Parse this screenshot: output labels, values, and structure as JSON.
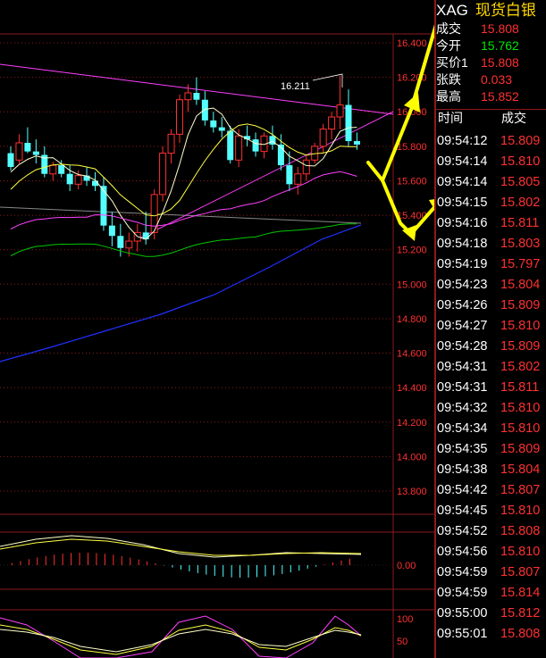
{
  "quote": {
    "code": "XAG",
    "name": "现货白银",
    "rows": [
      {
        "label": "成交",
        "value": "15.808",
        "color": "#ff3030"
      },
      {
        "label": "今开",
        "value": "15.762",
        "color": "#00e600"
      },
      {
        "label": "买价1",
        "value": "15.808",
        "color": "#ff3030"
      },
      {
        "label": "张跌",
        "value": "0.033",
        "color": "#ff3030"
      },
      {
        "label": "最高",
        "value": "15.852",
        "color": "#ff3030"
      }
    ]
  },
  "ticks": {
    "headers": [
      "时间",
      "成交"
    ],
    "rows": [
      {
        "time": "09:54:12",
        "price": "15.809"
      },
      {
        "time": "09:54:14",
        "price": "15.810"
      },
      {
        "time": "09:54:14",
        "price": "15.805"
      },
      {
        "time": "09:54:15",
        "price": "15.802"
      },
      {
        "time": "09:54:16",
        "price": "15.811"
      },
      {
        "time": "09:54:18",
        "price": "15.803"
      },
      {
        "time": "09:54:19",
        "price": "15.797"
      },
      {
        "time": "09:54:23",
        "price": "15.804"
      },
      {
        "time": "09:54:26",
        "price": "15.809"
      },
      {
        "time": "09:54:27",
        "price": "15.810"
      },
      {
        "time": "09:54:28",
        "price": "15.809"
      },
      {
        "time": "09:54:31",
        "price": "15.802"
      },
      {
        "time": "09:54:31",
        "price": "15.811"
      },
      {
        "time": "09:54:32",
        "price": "15.810"
      },
      {
        "time": "09:54:34",
        "price": "15.810"
      },
      {
        "time": "09:54:35",
        "price": "15.809"
      },
      {
        "time": "09:54:38",
        "price": "15.804"
      },
      {
        "time": "09:54:42",
        "price": "15.807"
      },
      {
        "time": "09:54:45",
        "price": "15.810"
      },
      {
        "time": "09:54:52",
        "price": "15.808"
      },
      {
        "time": "09:54:56",
        "price": "15.810"
      },
      {
        "time": "09:54:59",
        "price": "15.807"
      },
      {
        "time": "09:54:59",
        "price": "15.814"
      },
      {
        "time": "09:55:00",
        "price": "15.812"
      },
      {
        "time": "09:55:01",
        "price": "15.808"
      }
    ]
  },
  "chart": {
    "y_ticks": [
      "16.400",
      "16.200",
      "16.000",
      "15.800",
      "15.600",
      "15.400",
      "15.200",
      "15.000",
      "14.800",
      "14.600",
      "14.400",
      "14.200",
      "14.000",
      "13.800"
    ],
    "peak_label": "16.211",
    "macd_zero_label": "0.00",
    "kdj_labels": [
      "100",
      "50"
    ]
  },
  "colors": {
    "grid": "#8b1a1a",
    "up": "#ff3030",
    "down": "#54ffff",
    "ma5": "#ffffcc",
    "ma10": "#ffff40",
    "ma20": "#ff40ff",
    "ma60": "#00c800",
    "ma120": "#2030ff",
    "arrows": "#ffff00"
  },
  "chart_data": {
    "type": "candlestick",
    "candles": [
      {
        "o": 15.76,
        "h": 15.8,
        "l": 15.66,
        "c": 15.68
      },
      {
        "o": 15.72,
        "h": 15.87,
        "l": 15.7,
        "c": 15.82
      },
      {
        "o": 15.82,
        "h": 15.91,
        "l": 15.76,
        "c": 15.77
      },
      {
        "o": 15.77,
        "h": 15.84,
        "l": 15.7,
        "c": 15.75
      },
      {
        "o": 15.75,
        "h": 15.8,
        "l": 15.62,
        "c": 15.64
      },
      {
        "o": 15.64,
        "h": 15.71,
        "l": 15.6,
        "c": 15.69
      },
      {
        "o": 15.69,
        "h": 15.72,
        "l": 15.62,
        "c": 15.64
      },
      {
        "o": 15.64,
        "h": 15.69,
        "l": 15.54,
        "c": 15.58
      },
      {
        "o": 15.58,
        "h": 15.66,
        "l": 15.55,
        "c": 15.63
      },
      {
        "o": 15.63,
        "h": 15.68,
        "l": 15.57,
        "c": 15.6
      },
      {
        "o": 15.6,
        "h": 15.65,
        "l": 15.54,
        "c": 15.57
      },
      {
        "o": 15.57,
        "h": 15.62,
        "l": 15.31,
        "c": 15.34
      },
      {
        "o": 15.34,
        "h": 15.42,
        "l": 15.22,
        "c": 15.28
      },
      {
        "o": 15.28,
        "h": 15.35,
        "l": 15.16,
        "c": 15.21
      },
      {
        "o": 15.21,
        "h": 15.3,
        "l": 15.16,
        "c": 15.25
      },
      {
        "o": 15.25,
        "h": 15.35,
        "l": 15.19,
        "c": 15.3
      },
      {
        "o": 15.3,
        "h": 15.42,
        "l": 15.23,
        "c": 15.26
      },
      {
        "o": 15.3,
        "h": 15.55,
        "l": 15.26,
        "c": 15.52
      },
      {
        "o": 15.52,
        "h": 15.8,
        "l": 15.48,
        "c": 15.76
      },
      {
        "o": 15.76,
        "h": 15.9,
        "l": 15.7,
        "c": 15.87
      },
      {
        "o": 15.87,
        "h": 16.1,
        "l": 15.82,
        "c": 16.07
      },
      {
        "o": 16.07,
        "h": 16.16,
        "l": 16.0,
        "c": 16.11
      },
      {
        "o": 16.11,
        "h": 16.2,
        "l": 16.04,
        "c": 16.07
      },
      {
        "o": 16.07,
        "h": 16.12,
        "l": 15.92,
        "c": 15.95
      },
      {
        "o": 15.95,
        "h": 16.0,
        "l": 15.88,
        "c": 15.91
      },
      {
        "o": 15.91,
        "h": 15.97,
        "l": 15.85,
        "c": 15.89
      },
      {
        "o": 15.89,
        "h": 15.92,
        "l": 15.7,
        "c": 15.72
      },
      {
        "o": 15.72,
        "h": 15.9,
        "l": 15.68,
        "c": 15.86
      },
      {
        "o": 15.86,
        "h": 15.92,
        "l": 15.8,
        "c": 15.84
      },
      {
        "o": 15.84,
        "h": 15.88,
        "l": 15.74,
        "c": 15.77
      },
      {
        "o": 15.77,
        "h": 15.88,
        "l": 15.73,
        "c": 15.86
      },
      {
        "o": 15.86,
        "h": 15.92,
        "l": 15.78,
        "c": 15.81
      },
      {
        "o": 15.81,
        "h": 15.87,
        "l": 15.66,
        "c": 15.69
      },
      {
        "o": 15.69,
        "h": 15.77,
        "l": 15.54,
        "c": 15.58
      },
      {
        "o": 15.58,
        "h": 15.68,
        "l": 15.52,
        "c": 15.64
      },
      {
        "o": 15.64,
        "h": 15.75,
        "l": 15.6,
        "c": 15.72
      },
      {
        "o": 15.72,
        "h": 15.82,
        "l": 15.7,
        "c": 15.8
      },
      {
        "o": 15.8,
        "h": 15.93,
        "l": 15.76,
        "c": 15.9
      },
      {
        "o": 15.9,
        "h": 16.0,
        "l": 15.84,
        "c": 15.97
      },
      {
        "o": 15.97,
        "h": 16.21,
        "l": 15.9,
        "c": 16.04
      },
      {
        "o": 16.04,
        "h": 16.13,
        "l": 15.8,
        "c": 15.83
      },
      {
        "o": 15.83,
        "h": 15.88,
        "l": 15.78,
        "c": 15.81
      }
    ]
  }
}
